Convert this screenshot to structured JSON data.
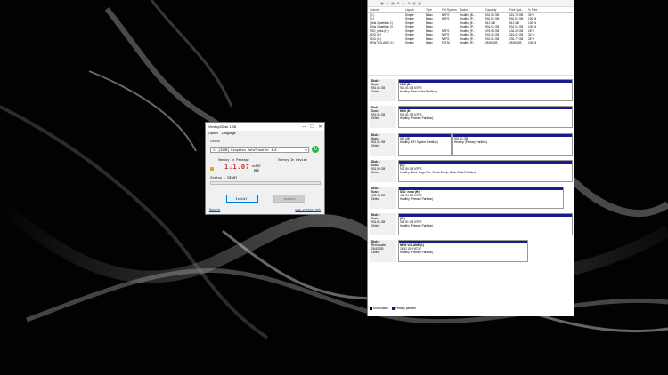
{
  "ventoy": {
    "title": "Ventoy2Disk 1.08",
    "win_min": "—",
    "win_max": "☐",
    "win_close": "✕",
    "menu": [
      "Option",
      "Language"
    ],
    "device_label": "Device",
    "device_value": "I: [32GB] Kingston DataTraveler 3.0",
    "device_arrow": "▾",
    "refresh_icon": "↻",
    "pkg_label": "Ventoy In Package",
    "dev_label": "Ventoy In Device",
    "pkg_version": "1.1.07",
    "fs_line1": "exFAT",
    "fs_line2": "MBR",
    "status": "Status - READY",
    "progress": 0,
    "install_label": "Install",
    "update_label": "Update",
    "donate_label": "Donate",
    "site_label": "www.ventoy.net"
  },
  "disk_management": {
    "toolbar_icons": [
      "←",
      "→",
      "▦",
      "?",
      "▤",
      "⚙",
      "✎",
      "⊞",
      "▥",
      "▣"
    ],
    "columns": [
      "Volume",
      "Layout",
      "Type",
      "File System",
      "Status",
      "Capacity",
      "Free Spa...",
      "% Free"
    ],
    "volumes": [
      [
        "(C:)",
        "Simple",
        "Basic",
        "NTFS",
        "Healthy (B...",
        "931.50 GB",
        "321.73 GB",
        "35 %"
      ],
      [
        "(E:)",
        "Simple",
        "Basic",
        "NTFS",
        "Healthy (P...",
        "931.51 GB",
        "931.51 GB",
        "100 %"
      ],
      [
        "(Disk 2 partition 1)",
        "Simple",
        "Basic",
        "",
        "Healthy (E...",
        "512 MB",
        "512 MB",
        "100 %"
      ],
      [
        "(Disk 2 partition 2)",
        "Simple",
        "Basic",
        "",
        "Healthy (P...",
        "931.01 GB",
        "931.01 GB",
        "100 %"
      ],
      [
        "SSD_extra (H:)",
        "Simple",
        "Basic",
        "NTFS",
        "Healthy (P...",
        "476.94 GB",
        "134.28 GB",
        "28 %"
      ],
      [
        "HDD (D:)",
        "Simple",
        "Basic",
        "NTFS",
        "Healthy (B...",
        "931.51 GB",
        "316.01 GB",
        "34 %"
      ],
      [
        "HDD (G:)",
        "Simple",
        "Basic",
        "NTFS",
        "Healthy (P...",
        "931.51 GB",
        "233.77 GB",
        "25 %"
      ],
      [
        "NEW VOLUME (I:)",
        "Simple",
        "Basic",
        "FAT32",
        "Healthy (P...",
        "28.80 GB",
        "28.80 GB",
        "100 %"
      ]
    ],
    "disks": [
      {
        "name": "Disk 0",
        "type": "Basic",
        "size": "931.51 GB",
        "state": "Online",
        "parts": [
          {
            "name": "HDD (D:)",
            "size": "931.51 GB NTFS",
            "status": "Healthy (Basic Data Partition)"
          }
        ]
      },
      {
        "name": "Disk 1",
        "type": "Basic",
        "size": "931.51 GB",
        "state": "Online",
        "parts": [
          {
            "name": "HDD (E:)",
            "size": "931.51 GB NTFS",
            "status": "Healthy (Primary Partition)"
          }
        ]
      },
      {
        "name": "Disk 2",
        "type": "Basic",
        "size": "931.51 GB",
        "state": "Online",
        "parts": [
          {
            "name": "",
            "size": "512 MB",
            "status": "Healthy (EFI System Partition)"
          },
          {
            "name": "",
            "size": "931.01 GB",
            "status": "Healthy (Primary Partition)"
          }
        ]
      },
      {
        "name": "Disk 3",
        "type": "Basic",
        "size": "931.50 GB",
        "state": "Online",
        "parts": [
          {
            "name": "(C:)",
            "size": "931.50 GB NTFS",
            "status": "Healthy (Boot, Page File, Crash Dump, Basic Data Partition)"
          }
        ]
      },
      {
        "name": "Disk 4",
        "type": "Basic",
        "size": "476.94 GB",
        "state": "Online",
        "parts": [
          {
            "name": "SSD_extra (H:)",
            "size": "476.94 GB NTFS",
            "status": "Healthy (Primary Partition)"
          }
        ]
      },
      {
        "name": "Disk 5",
        "type": "Basic",
        "size": "931.51 GB",
        "state": "Online",
        "parts": [
          {
            "name": "(G:)",
            "size": "931.51 GB NTFS",
            "status": "Healthy (Primary Partition)"
          }
        ]
      },
      {
        "name": "Disk 6",
        "type": "Removable",
        "size": "28.82 GB",
        "state": "Online",
        "parts": [
          {
            "name": "NEW VOLUME (I:)",
            "size": "28.82 GB FAT32",
            "status": "Healthy (Primary Partition)"
          }
        ]
      }
    ],
    "legend": [
      {
        "label": "Unallocated",
        "color": "#000000"
      },
      {
        "label": "Primary partition",
        "color": "#1a1a8a"
      }
    ]
  }
}
